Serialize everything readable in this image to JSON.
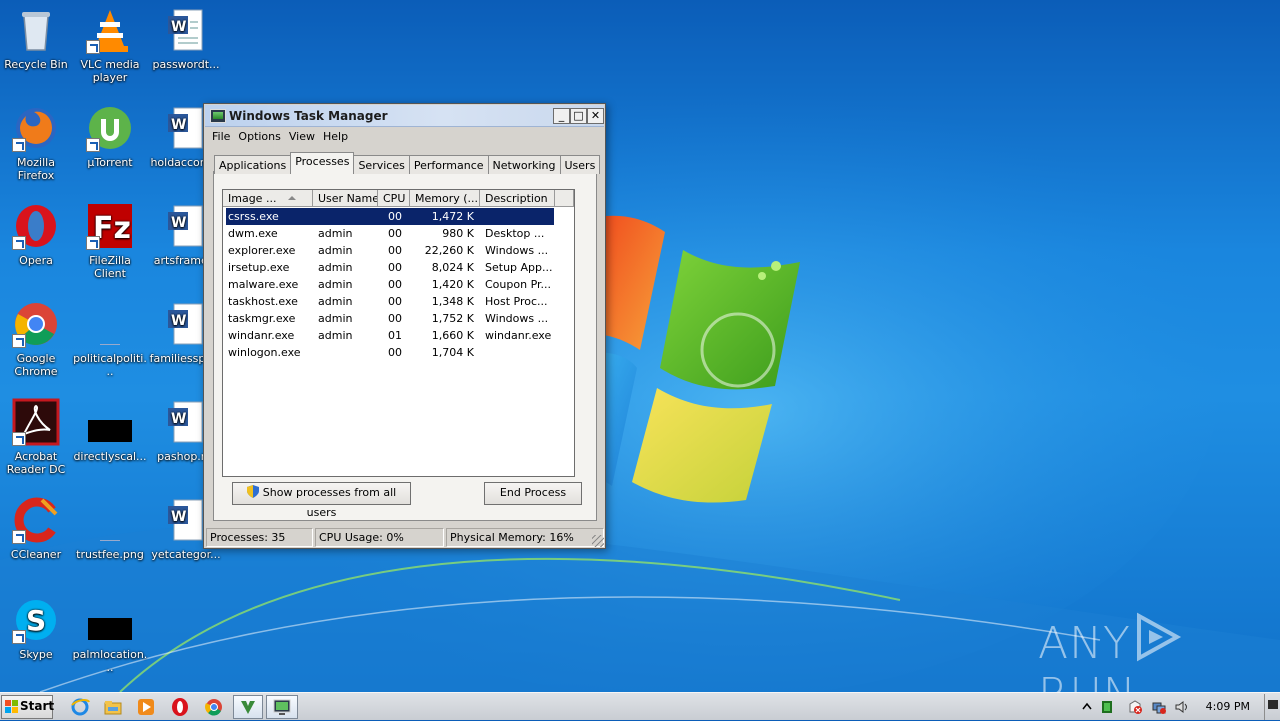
{
  "desktop": {
    "icons": [
      {
        "label": "Recycle Bin"
      },
      {
        "label": "VLC media player"
      },
      {
        "label": "passwordt..."
      },
      {
        "label": "Mozilla Firefox"
      },
      {
        "label": "µTorrent"
      },
      {
        "label": "holdaccord..."
      },
      {
        "label": "Opera"
      },
      {
        "label": "FileZilla Client"
      },
      {
        "label": "artsframe..."
      },
      {
        "label": "Google Chrome"
      },
      {
        "label": "politicalpoliti..."
      },
      {
        "label": "familiesspo..."
      },
      {
        "label": "Acrobat Reader DC"
      },
      {
        "label": "directlyscal..."
      },
      {
        "label": "pashop.r..."
      },
      {
        "label": "CCleaner"
      },
      {
        "label": "trustfee.png"
      },
      {
        "label": "yetcategor..."
      },
      {
        "label": "Skype"
      },
      {
        "label": "palmlocation..."
      }
    ]
  },
  "taskmgr": {
    "title": "Windows Task Manager",
    "menu": [
      "File",
      "Options",
      "View",
      "Help"
    ],
    "tabs": [
      "Applications",
      "Processes",
      "Services",
      "Performance",
      "Networking",
      "Users"
    ],
    "active_tab": "Processes",
    "columns": [
      "Image ...",
      "User Name",
      "CPU",
      "Memory (...",
      "Description"
    ],
    "processes": [
      {
        "name": "csrss.exe",
        "user": "",
        "cpu": "00",
        "memory": "1,472 K",
        "description": ""
      },
      {
        "name": "dwm.exe",
        "user": "admin",
        "cpu": "00",
        "memory": "980 K",
        "description": "Desktop ..."
      },
      {
        "name": "explorer.exe",
        "user": "admin",
        "cpu": "00",
        "memory": "22,260 K",
        "description": "Windows ..."
      },
      {
        "name": "irsetup.exe",
        "user": "admin",
        "cpu": "00",
        "memory": "8,024 K",
        "description": "Setup App..."
      },
      {
        "name": "malware.exe",
        "user": "admin",
        "cpu": "00",
        "memory": "1,420 K",
        "description": "Coupon Pr..."
      },
      {
        "name": "taskhost.exe",
        "user": "admin",
        "cpu": "00",
        "memory": "1,348 K",
        "description": "Host Proc..."
      },
      {
        "name": "taskmgr.exe",
        "user": "admin",
        "cpu": "00",
        "memory": "1,752 K",
        "description": "Windows ..."
      },
      {
        "name": "windanr.exe",
        "user": "admin",
        "cpu": "01",
        "memory": "1,660 K",
        "description": "windanr.exe"
      },
      {
        "name": "winlogon.exe",
        "user": "",
        "cpu": "00",
        "memory": "1,704 K",
        "description": ""
      }
    ],
    "show_all_label": "Show processes from all users",
    "end_process_label": "End Process",
    "status": {
      "processes": "Processes: 35",
      "cpu": "CPU Usage: 0%",
      "memory": "Physical Memory: 16%"
    },
    "minimize_glyph": "_",
    "maximize_glyph": "□",
    "close_glyph": "✕"
  },
  "watermark": {
    "left": "ANY",
    "right": "RUN"
  },
  "taskbar": {
    "start_label": "Start",
    "pinned": [
      "ie-icon",
      "explorer-icon",
      "media-player-icon",
      "opera-icon",
      "chrome-icon",
      "avast-icon",
      "task-manager-icon"
    ],
    "clock": "4:09 PM"
  }
}
